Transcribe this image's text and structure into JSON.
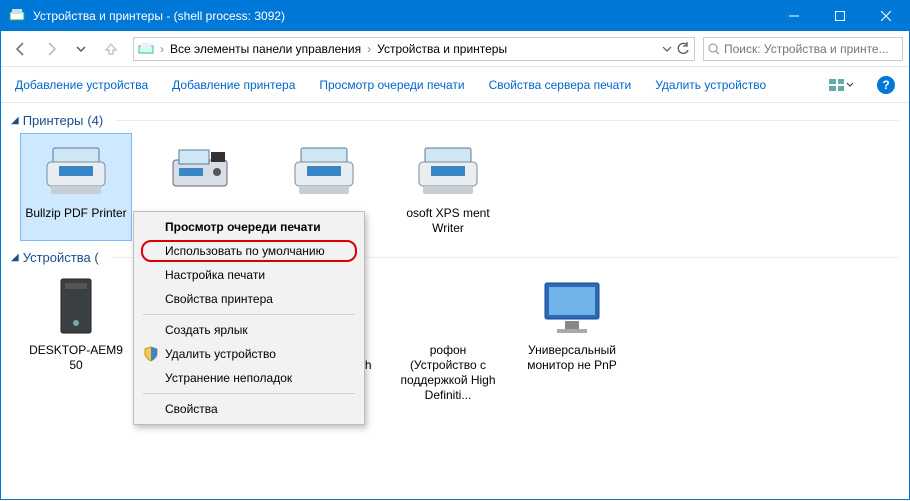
{
  "window": {
    "title": "Устройства и принтеры - (shell process: 3092)"
  },
  "breadcrumb": {
    "root": "Все элементы панели управления",
    "current": "Устройства и принтеры"
  },
  "search": {
    "placeholder": "Поиск: Устройства и принте..."
  },
  "toolbar": {
    "add_device": "Добавление устройства",
    "add_printer": "Добавление принтера",
    "view_queue": "Просмотр очереди печати",
    "server_props": "Свойства сервера печати",
    "remove_device": "Удалить устройство"
  },
  "groups": {
    "printers": {
      "title": "Принтеры",
      "count": "(4)"
    },
    "devices": {
      "title": "Устройства ("
    }
  },
  "printers": [
    {
      "label": "Bullzip PDF Printer"
    },
    {
      "label": ""
    },
    {
      "label": ""
    },
    {
      "label": "osoft XPS ment Writer"
    }
  ],
  "devices": [
    {
      "label": "DESKTOP-AEM9 50"
    },
    {
      "label": ""
    },
    {
      "label": "(Устройство с поддержкой High Definitio..."
    },
    {
      "label": "рофон (Устройство с поддержкой High Definiti..."
    },
    {
      "label": "Универсальный монитор не PnP"
    }
  ],
  "context_menu": {
    "view_queue": "Просмотр очереди печати",
    "set_default": "Использовать по умолчанию",
    "print_prefs": "Настройка печати",
    "printer_props": "Свойства принтера",
    "create_shortcut": "Создать ярлык",
    "remove": "Удалить устройство",
    "troubleshoot": "Устранение неполадок",
    "properties": "Свойства"
  }
}
